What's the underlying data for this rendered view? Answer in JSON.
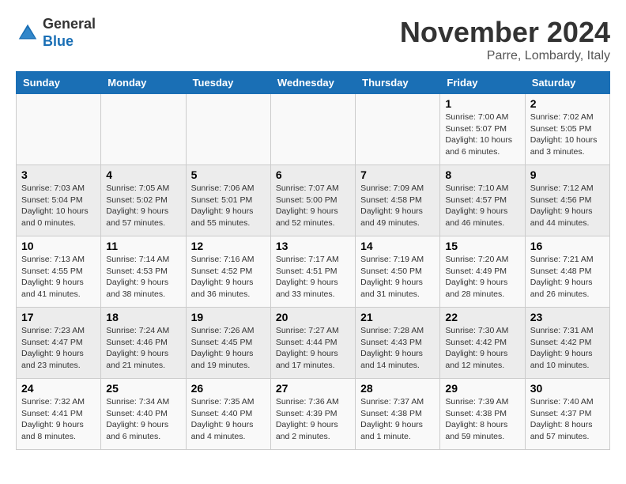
{
  "header": {
    "logo_general": "General",
    "logo_blue": "Blue",
    "month_title": "November 2024",
    "location": "Parre, Lombardy, Italy"
  },
  "columns": [
    "Sunday",
    "Monday",
    "Tuesday",
    "Wednesday",
    "Thursday",
    "Friday",
    "Saturday"
  ],
  "weeks": [
    [
      {
        "day": "",
        "info": ""
      },
      {
        "day": "",
        "info": ""
      },
      {
        "day": "",
        "info": ""
      },
      {
        "day": "",
        "info": ""
      },
      {
        "day": "",
        "info": ""
      },
      {
        "day": "1",
        "info": "Sunrise: 7:00 AM\nSunset: 5:07 PM\nDaylight: 10 hours\nand 6 minutes."
      },
      {
        "day": "2",
        "info": "Sunrise: 7:02 AM\nSunset: 5:05 PM\nDaylight: 10 hours\nand 3 minutes."
      }
    ],
    [
      {
        "day": "3",
        "info": "Sunrise: 7:03 AM\nSunset: 5:04 PM\nDaylight: 10 hours\nand 0 minutes."
      },
      {
        "day": "4",
        "info": "Sunrise: 7:05 AM\nSunset: 5:02 PM\nDaylight: 9 hours\nand 57 minutes."
      },
      {
        "day": "5",
        "info": "Sunrise: 7:06 AM\nSunset: 5:01 PM\nDaylight: 9 hours\nand 55 minutes."
      },
      {
        "day": "6",
        "info": "Sunrise: 7:07 AM\nSunset: 5:00 PM\nDaylight: 9 hours\nand 52 minutes."
      },
      {
        "day": "7",
        "info": "Sunrise: 7:09 AM\nSunset: 4:58 PM\nDaylight: 9 hours\nand 49 minutes."
      },
      {
        "day": "8",
        "info": "Sunrise: 7:10 AM\nSunset: 4:57 PM\nDaylight: 9 hours\nand 46 minutes."
      },
      {
        "day": "9",
        "info": "Sunrise: 7:12 AM\nSunset: 4:56 PM\nDaylight: 9 hours\nand 44 minutes."
      }
    ],
    [
      {
        "day": "10",
        "info": "Sunrise: 7:13 AM\nSunset: 4:55 PM\nDaylight: 9 hours\nand 41 minutes."
      },
      {
        "day": "11",
        "info": "Sunrise: 7:14 AM\nSunset: 4:53 PM\nDaylight: 9 hours\nand 38 minutes."
      },
      {
        "day": "12",
        "info": "Sunrise: 7:16 AM\nSunset: 4:52 PM\nDaylight: 9 hours\nand 36 minutes."
      },
      {
        "day": "13",
        "info": "Sunrise: 7:17 AM\nSunset: 4:51 PM\nDaylight: 9 hours\nand 33 minutes."
      },
      {
        "day": "14",
        "info": "Sunrise: 7:19 AM\nSunset: 4:50 PM\nDaylight: 9 hours\nand 31 minutes."
      },
      {
        "day": "15",
        "info": "Sunrise: 7:20 AM\nSunset: 4:49 PM\nDaylight: 9 hours\nand 28 minutes."
      },
      {
        "day": "16",
        "info": "Sunrise: 7:21 AM\nSunset: 4:48 PM\nDaylight: 9 hours\nand 26 minutes."
      }
    ],
    [
      {
        "day": "17",
        "info": "Sunrise: 7:23 AM\nSunset: 4:47 PM\nDaylight: 9 hours\nand 23 minutes."
      },
      {
        "day": "18",
        "info": "Sunrise: 7:24 AM\nSunset: 4:46 PM\nDaylight: 9 hours\nand 21 minutes."
      },
      {
        "day": "19",
        "info": "Sunrise: 7:26 AM\nSunset: 4:45 PM\nDaylight: 9 hours\nand 19 minutes."
      },
      {
        "day": "20",
        "info": "Sunrise: 7:27 AM\nSunset: 4:44 PM\nDaylight: 9 hours\nand 17 minutes."
      },
      {
        "day": "21",
        "info": "Sunrise: 7:28 AM\nSunset: 4:43 PM\nDaylight: 9 hours\nand 14 minutes."
      },
      {
        "day": "22",
        "info": "Sunrise: 7:30 AM\nSunset: 4:42 PM\nDaylight: 9 hours\nand 12 minutes."
      },
      {
        "day": "23",
        "info": "Sunrise: 7:31 AM\nSunset: 4:42 PM\nDaylight: 9 hours\nand 10 minutes."
      }
    ],
    [
      {
        "day": "24",
        "info": "Sunrise: 7:32 AM\nSunset: 4:41 PM\nDaylight: 9 hours\nand 8 minutes."
      },
      {
        "day": "25",
        "info": "Sunrise: 7:34 AM\nSunset: 4:40 PM\nDaylight: 9 hours\nand 6 minutes."
      },
      {
        "day": "26",
        "info": "Sunrise: 7:35 AM\nSunset: 4:40 PM\nDaylight: 9 hours\nand 4 minutes."
      },
      {
        "day": "27",
        "info": "Sunrise: 7:36 AM\nSunset: 4:39 PM\nDaylight: 9 hours\nand 2 minutes."
      },
      {
        "day": "28",
        "info": "Sunrise: 7:37 AM\nSunset: 4:38 PM\nDaylight: 9 hours\nand 1 minute."
      },
      {
        "day": "29",
        "info": "Sunrise: 7:39 AM\nSunset: 4:38 PM\nDaylight: 8 hours\nand 59 minutes."
      },
      {
        "day": "30",
        "info": "Sunrise: 7:40 AM\nSunset: 4:37 PM\nDaylight: 8 hours\nand 57 minutes."
      }
    ]
  ]
}
